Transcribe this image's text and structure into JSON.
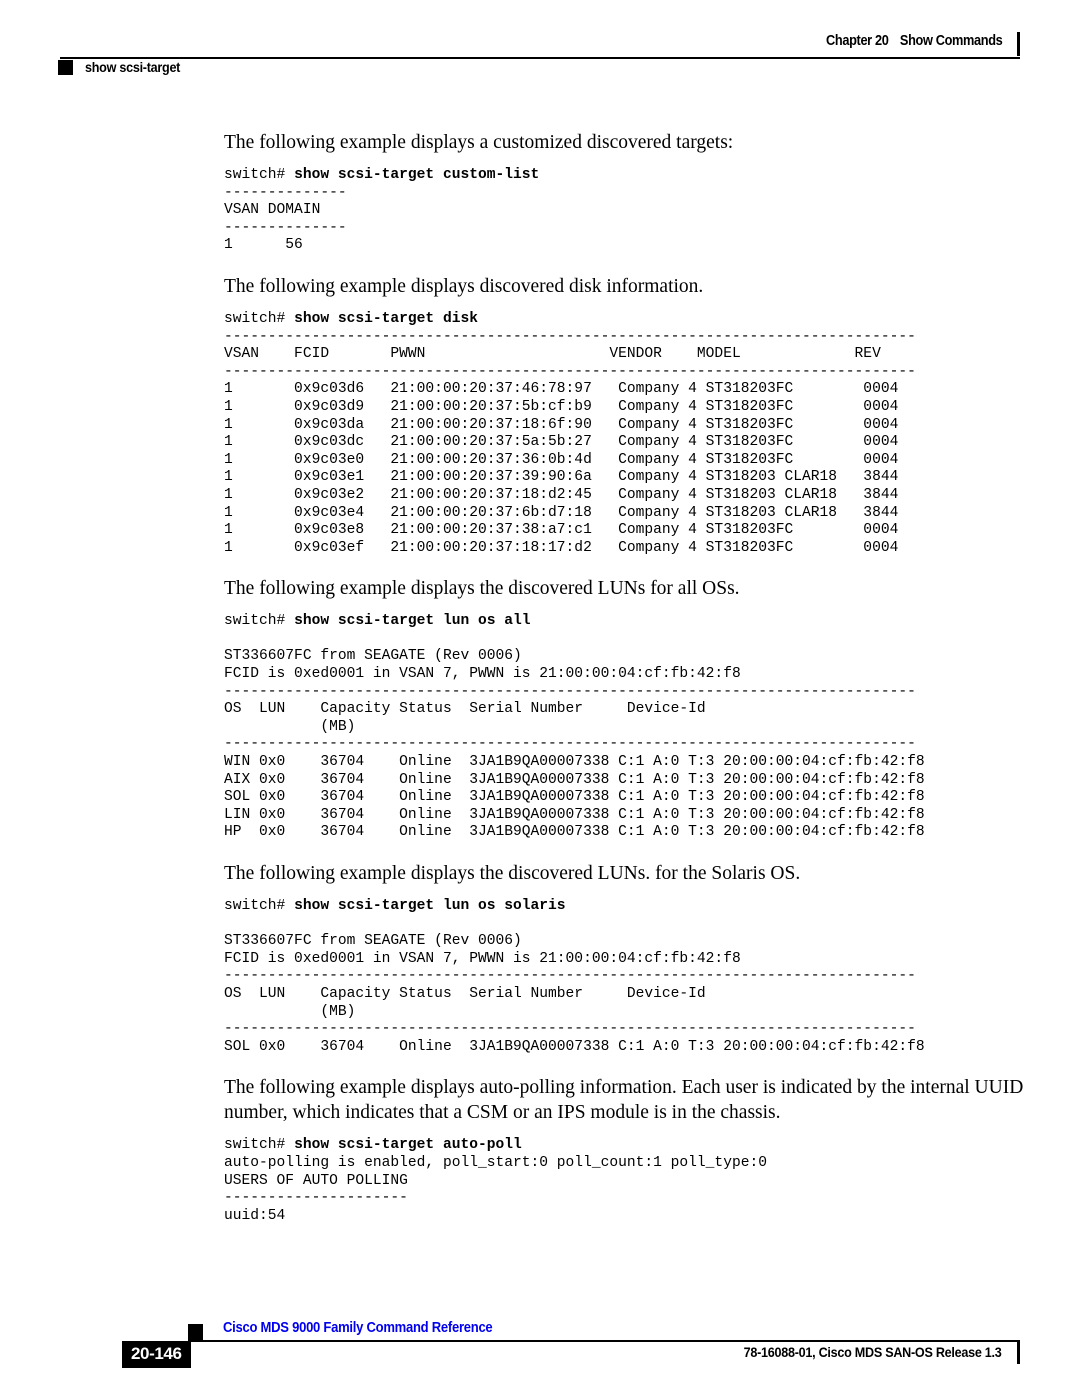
{
  "header": {
    "chapter": "Chapter 20",
    "section": "Show Commands",
    "command_marker": "show scsi-target"
  },
  "footer": {
    "book_title": "Cisco MDS 9000 Family Command Reference",
    "page_number": "20-146",
    "doc_id": "78-16088-01, Cisco MDS SAN-OS Release 1.3"
  },
  "sections": {
    "custom_list": {
      "intro": "The following example displays a customized discovered targets:",
      "prompt": "switch# ",
      "command": "show scsi-target custom-list",
      "output": "--------------\nVSAN DOMAIN\n--------------\n1      56"
    },
    "disk": {
      "intro": "The following example displays discovered disk information.",
      "prompt": "switch# ",
      "command": "show scsi-target disk",
      "rule": "-------------------------------------------------------------------------------",
      "header_row": "VSAN    FCID       PWWN                     VENDOR    MODEL             REV",
      "rows": [
        "1       0x9c03d6   21:00:00:20:37:46:78:97   Company 4 ST318203FC        0004",
        "1       0x9c03d9   21:00:00:20:37:5b:cf:b9   Company 4 ST318203FC        0004",
        "1       0x9c03da   21:00:00:20:37:18:6f:90   Company 4 ST318203FC        0004",
        "1       0x9c03dc   21:00:00:20:37:5a:5b:27   Company 4 ST318203FC        0004",
        "1       0x9c03e0   21:00:00:20:37:36:0b:4d   Company 4 ST318203FC        0004",
        "1       0x9c03e1   21:00:00:20:37:39:90:6a   Company 4 ST318203 CLAR18   3844",
        "1       0x9c03e2   21:00:00:20:37:18:d2:45   Company 4 ST318203 CLAR18   3844",
        "1       0x9c03e4   21:00:00:20:37:6b:d7:18   Company 4 ST318203 CLAR18   3844",
        "1       0x9c03e8   21:00:00:20:37:38:a7:c1   Company 4 ST318203FC        0004",
        "1       0x9c03ef   21:00:00:20:37:18:17:d2   Company 4 ST318203FC        0004"
      ]
    },
    "lun_all": {
      "intro": "The following example displays the discovered LUNs for all OSs.",
      "prompt": "switch# ",
      "command": "show scsi-target lun os all",
      "device_line": "ST336607FC from SEAGATE (Rev 0006)",
      "fcid_line": "FCID is 0xed0001 in VSAN 7, PWWN is 21:00:00:04:cf:fb:42:f8",
      "rule": "-------------------------------------------------------------------------------",
      "header_row1": "OS  LUN    Capacity Status  Serial Number     Device-Id",
      "header_row2": "           (MB)",
      "rows": [
        "WIN 0x0    36704    Online  3JA1B9QA00007338 C:1 A:0 T:3 20:00:00:04:cf:fb:42:f8",
        "AIX 0x0    36704    Online  3JA1B9QA00007338 C:1 A:0 T:3 20:00:00:04:cf:fb:42:f8",
        "SOL 0x0    36704    Online  3JA1B9QA00007338 C:1 A:0 T:3 20:00:00:04:cf:fb:42:f8",
        "LIN 0x0    36704    Online  3JA1B9QA00007338 C:1 A:0 T:3 20:00:00:04:cf:fb:42:f8",
        "HP  0x0    36704    Online  3JA1B9QA00007338 C:1 A:0 T:3 20:00:00:04:cf:fb:42:f8"
      ]
    },
    "lun_solaris": {
      "intro": "The following example displays the discovered LUNs. for the Solaris OS.",
      "prompt": "switch# ",
      "command": "show scsi-target lun os solaris",
      "device_line": "ST336607FC from SEAGATE (Rev 0006)",
      "fcid_line": "FCID is 0xed0001 in VSAN 7, PWWN is 21:00:00:04:cf:fb:42:f8",
      "rule": "-------------------------------------------------------------------------------",
      "header_row1": "OS  LUN    Capacity Status  Serial Number     Device-Id",
      "header_row2": "           (MB)",
      "rows": [
        "SOL 0x0    36704    Online  3JA1B9QA00007338 C:1 A:0 T:3 20:00:00:04:cf:fb:42:f8"
      ]
    },
    "auto_poll": {
      "intro": "The following example displays auto-polling information. Each user is indicated by the internal UUID number, which indicates that a CSM or an IPS module is in the chassis.",
      "prompt": "switch# ",
      "command": "show scsi-target auto-poll",
      "output": "auto-polling is enabled, poll_start:0 poll_count:1 poll_type:0\nUSERS OF AUTO POLLING\n---------------------\nuuid:54"
    }
  }
}
